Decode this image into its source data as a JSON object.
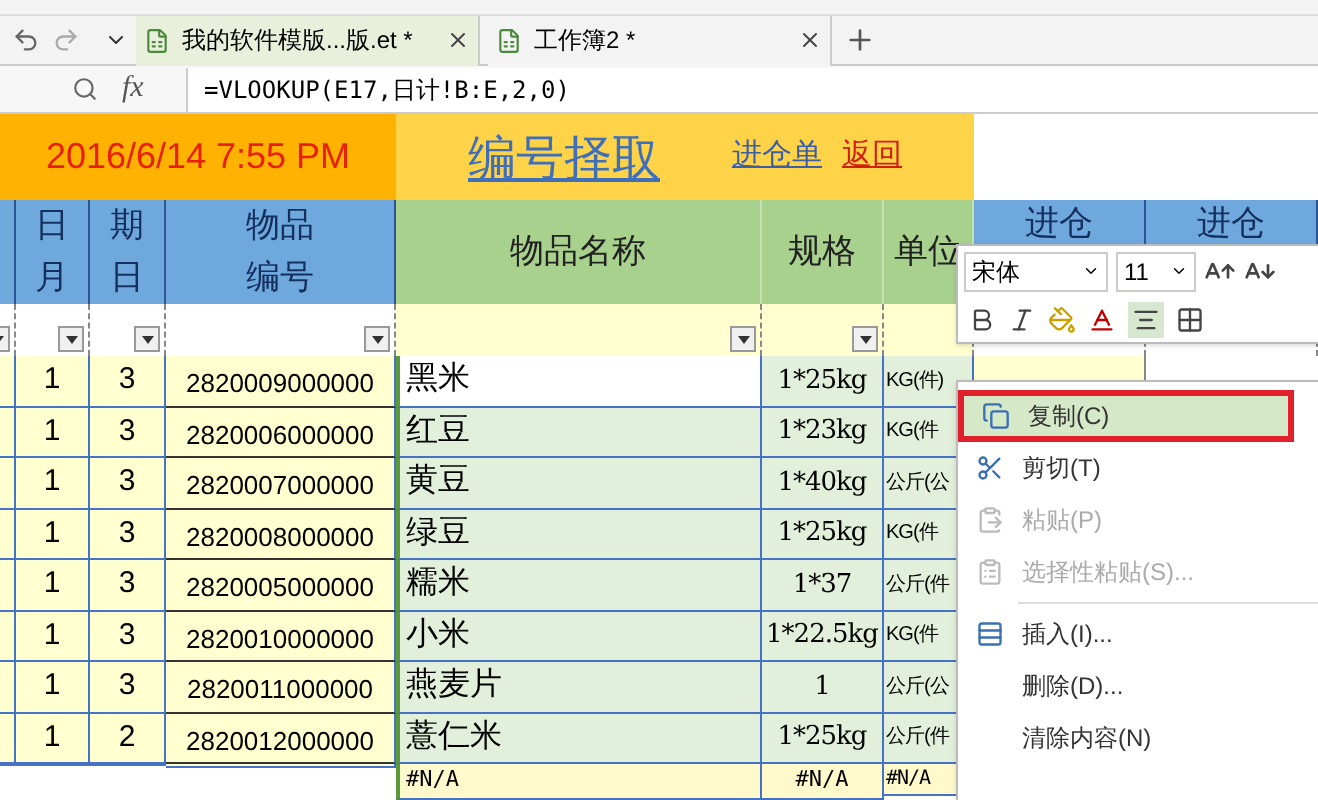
{
  "tabs_bar": {
    "tabs": [
      {
        "label": "我的软件模版...版.et *",
        "selected": true
      },
      {
        "label": "工作簿2 *",
        "selected": false
      }
    ]
  },
  "formula_bar": {
    "fx": "fx",
    "formula": "=VLOOKUP(E17,日计!B:E,2,0)"
  },
  "banner": {
    "datetime": "2016/6/14 7:55 PM",
    "title": "编号择取",
    "links": [
      {
        "label": "进仓单",
        "kind": "blue"
      },
      {
        "label": "返回",
        "kind": "red"
      }
    ]
  },
  "table": {
    "columns": [
      {
        "lines": [
          "日",
          "月"
        ],
        "kind": "blue"
      },
      {
        "lines": [
          "期",
          "日"
        ],
        "kind": "blue"
      },
      {
        "lines": [
          "物品",
          "编号"
        ],
        "kind": "blue"
      },
      {
        "lines": [
          "物品名称"
        ],
        "kind": "green"
      },
      {
        "lines": [
          "规格"
        ],
        "kind": "green"
      },
      {
        "lines": [
          "单位"
        ],
        "kind": "green"
      },
      {
        "lines": [
          "进仓"
        ],
        "kind": "blue"
      },
      {
        "lines": [
          "进仓"
        ],
        "kind": "blue"
      }
    ],
    "rows": [
      {
        "month": "1",
        "day": "3",
        "code": "2820009000000",
        "name": "黑米",
        "spec": "1*25kg",
        "unit": "KG(件)",
        "selected": true
      },
      {
        "month": "1",
        "day": "3",
        "code": "2820006000000",
        "name": "红豆",
        "spec": "1*23kg",
        "unit": "KG(件",
        "selected": false
      },
      {
        "month": "1",
        "day": "3",
        "code": "2820007000000",
        "name": "黄豆",
        "spec": "1*40kg",
        "unit": "公斤(公",
        "selected": false
      },
      {
        "month": "1",
        "day": "3",
        "code": "2820008000000",
        "name": "绿豆",
        "spec": "1*25kg",
        "unit": "KG(件",
        "selected": false
      },
      {
        "month": "1",
        "day": "3",
        "code": "2820005000000",
        "name": "糯米",
        "spec": "1*37",
        "unit": "公斤(件",
        "selected": false
      },
      {
        "month": "1",
        "day": "3",
        "code": "2820010000000",
        "name": "小米",
        "spec": "1*22.5kg",
        "unit": "KG(件",
        "selected": false
      },
      {
        "month": "1",
        "day": "3",
        "code": "2820011000000",
        "name": "燕麦片",
        "spec": "1",
        "unit": "公斤(公",
        "selected": false
      },
      {
        "month": "1",
        "day": "2",
        "code": "2820012000000",
        "name": "薏仁米",
        "spec": "1*25kg",
        "unit": "公斤(件",
        "selected": false
      },
      {
        "name": "#N/A",
        "spec": "#N/A",
        "unit": "#N/A",
        "selected": false
      }
    ]
  },
  "mini_toolbar": {
    "font": "宋体",
    "size": "11"
  },
  "context_menu": {
    "items": [
      {
        "label": "复制(C)",
        "kind": "copy",
        "selected": true,
        "disabled": false
      },
      {
        "label": "剪切(T)",
        "kind": "cut",
        "selected": false,
        "disabled": false
      },
      {
        "label": "粘贴(P)",
        "kind": "paste",
        "selected": false,
        "disabled": true
      },
      {
        "label": "选择性粘贴(S)...",
        "kind": "paste-special",
        "selected": false,
        "disabled": true,
        "separator_after": true
      },
      {
        "label": "插入(I)...",
        "kind": "insert",
        "selected": false,
        "disabled": false
      },
      {
        "label": "删除(D)...",
        "selected": false,
        "disabled": false
      },
      {
        "label": "清除内容(N)",
        "selected": false,
        "disabled": false
      }
    ]
  }
}
